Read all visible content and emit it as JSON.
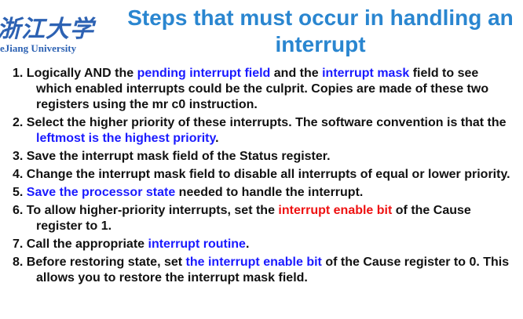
{
  "logo": {
    "cn": "浙江大学",
    "en": "eJiang University"
  },
  "title": "Steps that must occur in handling an interrupt",
  "colors": {
    "title": "#2a86d0",
    "highlight_blue": "#1a1aff",
    "highlight_red": "#ee1111",
    "logo": "#2d62b3"
  },
  "steps": [
    {
      "num": "1.",
      "parts": [
        {
          "text": "Logically AND the "
        },
        {
          "text": "pending interrupt field",
          "color": "blue"
        },
        {
          "text": " and the "
        },
        {
          "text": "interrupt mask",
          "color": "blue"
        },
        {
          "text": " field to see which enabled interrupts could be the culprit. Copies are made of these two registers using the mr c0 instruction."
        }
      ]
    },
    {
      "num": "2.",
      "parts": [
        {
          "text": "Select the higher priority of these interrupts. The software convention is that the "
        },
        {
          "text": "leftmost is the highest priority",
          "color": "blue"
        },
        {
          "text": "."
        }
      ]
    },
    {
      "num": "3.",
      "parts": [
        {
          "text": "Save the interrupt mask field of the Status register."
        }
      ]
    },
    {
      "num": "4.",
      "parts": [
        {
          "text": "Change the interrupt mask field to disable all interrupts of equal or lower priority."
        }
      ]
    },
    {
      "num": "5.",
      "parts": [
        {
          "text": "Save the processor state",
          "color": "blue"
        },
        {
          "text": " needed to handle the interrupt."
        }
      ]
    },
    {
      "num": "6.",
      "parts": [
        {
          "text": "To allow higher-priority interrupts, set the "
        },
        {
          "text": "interrupt enable bit",
          "color": "red"
        },
        {
          "text": " of the Cause register to 1."
        }
      ]
    },
    {
      "num": "7.",
      "parts": [
        {
          "text": "Call the appropriate "
        },
        {
          "text": "interrupt routine",
          "color": "blue"
        },
        {
          "text": "."
        }
      ]
    },
    {
      "num": "8.",
      "parts": [
        {
          "text": "Before restoring state, set "
        },
        {
          "text": "the interrupt enable bit",
          "color": "blue"
        },
        {
          "text": " of the Cause register to 0. This allows you to restore the interrupt mask field."
        }
      ]
    }
  ]
}
